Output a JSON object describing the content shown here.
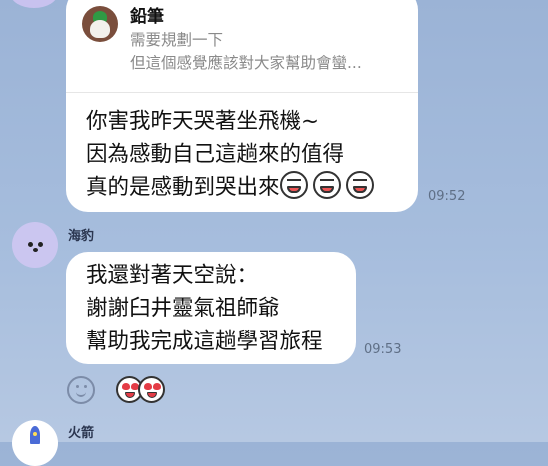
{
  "messages": [
    {
      "reply": {
        "sender": "鉛筆",
        "line1": "需要規劃一下",
        "line2": "但這個感覺應該對大家幫助會蠻..."
      },
      "lines": [
        "你害我昨天哭著坐飛機~",
        "因為感動自己這趟來的值得",
        "真的是感動到哭出來"
      ],
      "emoji_count": 3,
      "emoji_icon": "laughing-crying-face-icon",
      "time": "09:52"
    },
    {
      "sender": "海豹",
      "lines": [
        "我還對著天空說：",
        "謝謝臼井靈氣祖師爺",
        "幫助我完成這趟學習旅程"
      ],
      "time": "09:53"
    }
  ],
  "reaction_bar": {
    "add_reaction_icon": "smiley-face-icon",
    "reaction_icon": "heart-eyes-face-icon",
    "reaction_count_shown": 2
  },
  "next_sender": "火箭",
  "colors": {
    "background": "#a6bddd",
    "bubble": "#ffffff",
    "time": "#5f6f86"
  }
}
